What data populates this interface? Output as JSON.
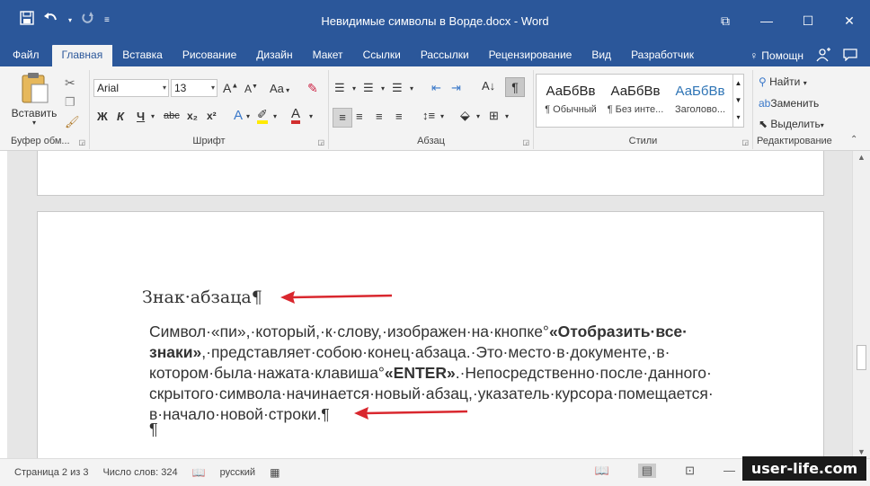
{
  "window": {
    "title": "Невидимые символы в Ворде.docx  -  Word",
    "controls": [
      "⧉",
      "—",
      "☐",
      "✕"
    ]
  },
  "qat": [
    "save-icon",
    "undo-icon",
    "redo-icon",
    "customize-icon"
  ],
  "tabs": [
    {
      "label": "Файл"
    },
    {
      "label": "Главная"
    },
    {
      "label": "Вставка"
    },
    {
      "label": "Рисование"
    },
    {
      "label": "Дизайн"
    },
    {
      "label": "Макет"
    },
    {
      "label": "Ссылки"
    },
    {
      "label": "Рассылки"
    },
    {
      "label": "Рецензирование"
    },
    {
      "label": "Вид"
    },
    {
      "label": "Разработчик"
    }
  ],
  "tell_me": "Помощн",
  "ribbon": {
    "clipboard": {
      "label": "Буфер обм...",
      "paste": "Вставить"
    },
    "font": {
      "label": "Шрифт",
      "font_name": "Arial",
      "font_size": "13",
      "bold": "Ж",
      "italic": "К",
      "underline": "Ч",
      "strike": "abc",
      "subscript": "x₂",
      "superscript": "x²",
      "grow": "A",
      "shrink": "A",
      "case": "Aa"
    },
    "paragraph": {
      "label": "Абзац"
    },
    "styles": {
      "label": "Стили",
      "items": [
        {
          "sample": "АаБбВв",
          "name": "¶ Обычный"
        },
        {
          "sample": "АаБбВв",
          "name": "¶ Без инте..."
        },
        {
          "sample": "АаБбВв",
          "name": "Заголово..."
        }
      ]
    },
    "editing": {
      "label": "Редактирование",
      "find": "Найти",
      "replace": "Заменить",
      "select": "Выделить"
    }
  },
  "document": {
    "heading": "Знак·абзаца¶",
    "body_parts": [
      {
        "text": "Символ·«пи»,·который,·к·слову,·изображен·на·кнопке°",
        "bold": false
      },
      {
        "text": "«Отобразить·все· знаки»",
        "bold": true
      },
      {
        "text": ",·представляет·собою·конец·абзаца.·Это·место·в·документе,·в· котором·была·нажата·клавиша°",
        "bold": false
      },
      {
        "text": "«ENTER»",
        "bold": true
      },
      {
        "text": ".·Непосредственно·после·данного· скрытого·символа·начинается·новый·абзац,·указатель·курсора·помещается· в·начало·новой·строки.¶",
        "bold": false
      }
    ],
    "empty_paragraph": "¶"
  },
  "statusbar": {
    "page": "Страница 2 из 3",
    "words": "Число слов: 324",
    "language": "русский"
  },
  "watermark": "user-life.com",
  "colors": {
    "accent": "#2b579a",
    "arrow": "#d9272e"
  }
}
